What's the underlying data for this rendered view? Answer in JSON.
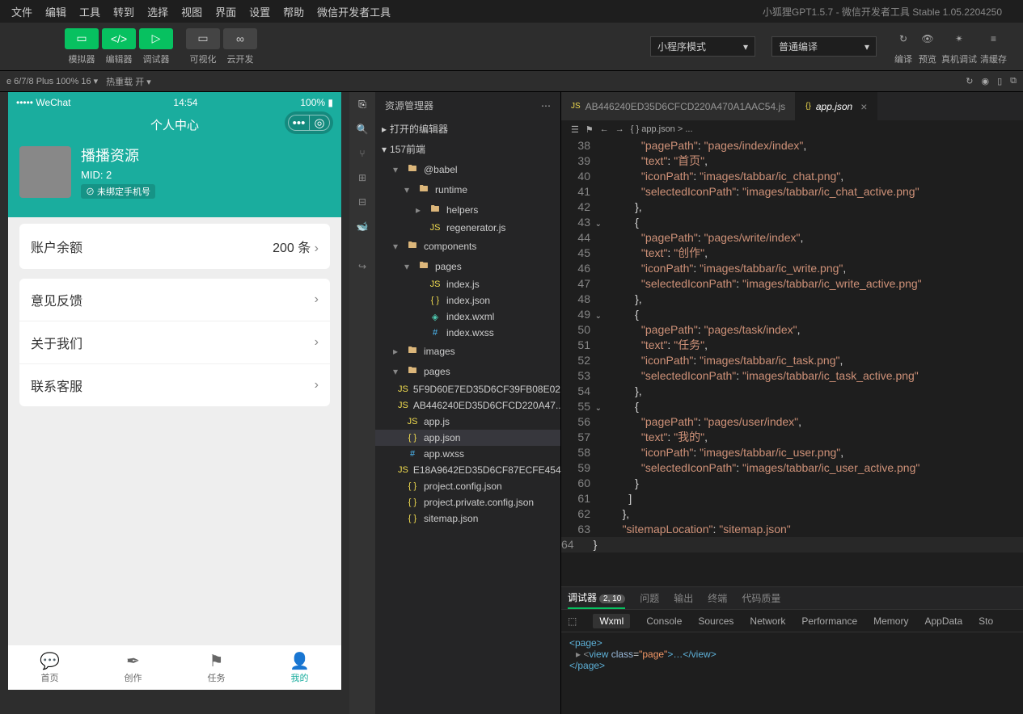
{
  "menubar": {
    "items": [
      "文件",
      "编辑",
      "工具",
      "转到",
      "选择",
      "视图",
      "界面",
      "设置",
      "帮助",
      "微信开发者工具"
    ],
    "title": "小狐狸GPT1.5.7 - 微信开发者工具 Stable 1.05.2204250"
  },
  "toolbar": {
    "group1": [
      {
        "icon": "▭",
        "label": "模拟器"
      },
      {
        "icon": "</>",
        "label": "编辑器"
      },
      {
        "icon": "▷",
        "label": "调试器"
      }
    ],
    "group2": [
      {
        "icon": "▭",
        "label": "可视化"
      },
      {
        "icon": "∞",
        "label": "云开发"
      }
    ],
    "select1": "小程序模式",
    "select2": "普通编译",
    "group3": [
      {
        "icon": "↻",
        "label": "编译"
      },
      {
        "icon": "👁",
        "label": "预览"
      },
      {
        "icon": "✴",
        "label": "真机调试"
      },
      {
        "icon": "≡",
        "label": "清缓存"
      }
    ]
  },
  "statusbar": {
    "device": "e 6/7/8 Plus 100% 16 ▾",
    "hot": "热重载 开 ▾"
  },
  "phone": {
    "status": {
      "carrier": "••••• WeChat",
      "time": "14:54",
      "battery": "100%"
    },
    "nav_title": "个人中心",
    "user": {
      "name": "播播资源",
      "mid": "MID: 2",
      "tag": "⊘ 未绑定手机号"
    },
    "balance": {
      "label": "账户余额",
      "value": "200 条"
    },
    "list": [
      "意见反馈",
      "关于我们",
      "联系客服"
    ],
    "tabs": [
      {
        "icon": "💬",
        "label": "首页"
      },
      {
        "icon": "✒",
        "label": "创作"
      },
      {
        "icon": "⚑",
        "label": "任务"
      },
      {
        "icon": "👤",
        "label": "我的"
      }
    ]
  },
  "explorer": {
    "title": "资源管理器",
    "sections": [
      "打开的编辑器",
      "157前端"
    ],
    "tree": [
      {
        "indent": 1,
        "icon": "▸",
        "ficon": "folder",
        "name": "@babel",
        "open": true,
        "arrow": "▾"
      },
      {
        "indent": 2,
        "icon": "▸",
        "ficon": "folder",
        "name": "runtime",
        "open": true,
        "arrow": "▾"
      },
      {
        "indent": 3,
        "arrow": "▸",
        "ficon": "folder",
        "name": "helpers"
      },
      {
        "indent": 3,
        "ficon": "js",
        "name": "regenerator.js"
      },
      {
        "indent": 1,
        "arrow": "▾",
        "ficon": "folder",
        "name": "components"
      },
      {
        "indent": 2,
        "arrow": "▾",
        "ficon": "folder",
        "name": "pages"
      },
      {
        "indent": 3,
        "ficon": "js",
        "name": "index.js"
      },
      {
        "indent": 3,
        "ficon": "json",
        "name": "index.json"
      },
      {
        "indent": 3,
        "ficon": "wxml",
        "name": "index.wxml"
      },
      {
        "indent": 3,
        "ficon": "wxss",
        "name": "index.wxss"
      },
      {
        "indent": 1,
        "arrow": "▸",
        "ficon": "folder",
        "name": "images"
      },
      {
        "indent": 1,
        "arrow": "▾",
        "ficon": "folder",
        "name": "pages"
      },
      {
        "indent": 1,
        "ficon": "js",
        "name": "5F9D60E7ED35D6CF39FB08E02..."
      },
      {
        "indent": 1,
        "ficon": "js",
        "name": "AB446240ED35D6CFCD220A47..."
      },
      {
        "indent": 1,
        "ficon": "js",
        "name": "app.js"
      },
      {
        "indent": 1,
        "ficon": "json",
        "name": "app.json",
        "selected": true
      },
      {
        "indent": 1,
        "ficon": "wxss",
        "name": "app.wxss"
      },
      {
        "indent": 1,
        "ficon": "js",
        "name": "E18A9642ED35D6CF87ECFE454..."
      },
      {
        "indent": 1,
        "ficon": "json",
        "name": "project.config.json"
      },
      {
        "indent": 1,
        "ficon": "json",
        "name": "project.private.config.json"
      },
      {
        "indent": 1,
        "ficon": "json",
        "name": "sitemap.json"
      }
    ]
  },
  "editor": {
    "tabs": [
      {
        "icon": "JS",
        "label": "AB446240ED35D6CFCD220A470A1AAC54.js"
      },
      {
        "icon": "{}",
        "label": "app.json",
        "active": true
      }
    ],
    "breadcrumb": "{ } app.json > ...",
    "lines": [
      {
        "n": 38,
        "html": "          <span class='s-str'>\"pagePath\"</span><span class='s-pun'>: </span><span class='s-str'>\"pages/index/index\"</span><span class='s-pun'>,</span>"
      },
      {
        "n": 39,
        "html": "          <span class='s-str'>\"text\"</span><span class='s-pun'>: </span><span class='s-str'>\"首页\"</span><span class='s-pun'>,</span>"
      },
      {
        "n": 40,
        "html": "          <span class='s-str'>\"iconPath\"</span><span class='s-pun'>: </span><span class='s-str'>\"images/tabbar/ic_chat.png\"</span><span class='s-pun'>,</span>"
      },
      {
        "n": 41,
        "html": "          <span class='s-str'>\"selectedIconPath\"</span><span class='s-pun'>: </span><span class='s-str'>\"images/tabbar/ic_chat_active.png\"</span>"
      },
      {
        "n": 42,
        "html": "        <span class='s-pun'>},</span>"
      },
      {
        "n": 43,
        "fold": "⌄",
        "html": "        <span class='s-pun'>{</span>"
      },
      {
        "n": 44,
        "html": "          <span class='s-str'>\"pagePath\"</span><span class='s-pun'>: </span><span class='s-str'>\"pages/write/index\"</span><span class='s-pun'>,</span>"
      },
      {
        "n": 45,
        "html": "          <span class='s-str'>\"text\"</span><span class='s-pun'>: </span><span class='s-str'>\"创作\"</span><span class='s-pun'>,</span>"
      },
      {
        "n": 46,
        "html": "          <span class='s-str'>\"iconPath\"</span><span class='s-pun'>: </span><span class='s-str'>\"images/tabbar/ic_write.png\"</span><span class='s-pun'>,</span>"
      },
      {
        "n": 47,
        "html": "          <span class='s-str'>\"selectedIconPath\"</span><span class='s-pun'>: </span><span class='s-str'>\"images/tabbar/ic_write_active.png\"</span>"
      },
      {
        "n": 48,
        "html": "        <span class='s-pun'>},</span>"
      },
      {
        "n": 49,
        "fold": "⌄",
        "html": "        <span class='s-pun'>{</span>"
      },
      {
        "n": 50,
        "html": "          <span class='s-str'>\"pagePath\"</span><span class='s-pun'>: </span><span class='s-str'>\"pages/task/index\"</span><span class='s-pun'>,</span>"
      },
      {
        "n": 51,
        "html": "          <span class='s-str'>\"text\"</span><span class='s-pun'>: </span><span class='s-str'>\"任务\"</span><span class='s-pun'>,</span>"
      },
      {
        "n": 52,
        "html": "          <span class='s-str'>\"iconPath\"</span><span class='s-pun'>: </span><span class='s-str'>\"images/tabbar/ic_task.png\"</span><span class='s-pun'>,</span>"
      },
      {
        "n": 53,
        "html": "          <span class='s-str'>\"selectedIconPath\"</span><span class='s-pun'>: </span><span class='s-str'>\"images/tabbar/ic_task_active.png\"</span>"
      },
      {
        "n": 54,
        "html": "        <span class='s-pun'>},</span>"
      },
      {
        "n": 55,
        "fold": "⌄",
        "html": "        <span class='s-pun'>{</span>"
      },
      {
        "n": 56,
        "html": "          <span class='s-str'>\"pagePath\"</span><span class='s-pun'>: </span><span class='s-str'>\"pages/user/index\"</span><span class='s-pun'>,</span>"
      },
      {
        "n": 57,
        "html": "          <span class='s-str'>\"text\"</span><span class='s-pun'>: </span><span class='s-str'>\"我的\"</span><span class='s-pun'>,</span>"
      },
      {
        "n": 58,
        "html": "          <span class='s-str'>\"iconPath\"</span><span class='s-pun'>: </span><span class='s-str'>\"images/tabbar/ic_user.png\"</span><span class='s-pun'>,</span>"
      },
      {
        "n": 59,
        "html": "          <span class='s-str'>\"selectedIconPath\"</span><span class='s-pun'>: </span><span class='s-str'>\"images/tabbar/ic_user_active.png\"</span>"
      },
      {
        "n": 60,
        "html": "        <span class='s-pun'>}</span>"
      },
      {
        "n": 61,
        "html": "      <span class='s-pun'>]</span>"
      },
      {
        "n": 62,
        "html": "    <span class='s-pun'>},</span>"
      },
      {
        "n": 63,
        "html": "    <span class='s-str'>\"sitemapLocation\"</span><span class='s-pun'>: </span><span class='s-str'>\"sitemap.json\"</span>"
      },
      {
        "n": 64,
        "cur": true,
        "html": "<span class='s-pun'>}</span>"
      }
    ]
  },
  "debug": {
    "tabs": [
      {
        "label": "调试器",
        "badge": "2, 10",
        "active": true
      },
      {
        "label": "问题"
      },
      {
        "label": "输出"
      },
      {
        "label": "终端"
      },
      {
        "label": "代码质量"
      }
    ],
    "subtabs": [
      "Wxml",
      "Console",
      "Sources",
      "Network",
      "Performance",
      "Memory",
      "AppData",
      "Sto"
    ],
    "wxml": {
      "l1": "<page>",
      "l2_open": "▸ <",
      "l2_tag": "view",
      "l2_class_attr": "class",
      "l2_class_val": "\"page\"",
      "l2_mid": ">…</",
      "l2_tag2": "view",
      "l2_close": ">",
      "l3": "</page>"
    }
  }
}
